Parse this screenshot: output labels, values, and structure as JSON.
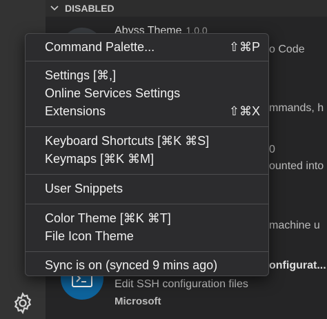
{
  "section": {
    "header": "DISABLED"
  },
  "extensions": [
    {
      "title": "Abyss Theme",
      "version": "1.0.0"
    }
  ],
  "background_fragments": {
    "frag1": "o Code",
    "frag2": "mmands, h",
    "frag3": "0",
    "frag4": "ounted into",
    "frag5": "machine u"
  },
  "ssh_extension": {
    "title": "SSH - configurat...",
    "title_visible": "onfigurat...",
    "description": "Edit SSH configuration files",
    "publisher": "Microsoft"
  },
  "menu": {
    "command_palette": {
      "label": "Command Palette...",
      "shortcut": "⇧⌘P"
    },
    "settings": {
      "label": "Settings [⌘,]"
    },
    "online_services": {
      "label": "Online Services Settings"
    },
    "extensions": {
      "label": "Extensions",
      "shortcut": "⇧⌘X"
    },
    "keyboard_shortcuts": {
      "label": "Keyboard Shortcuts [⌘K ⌘S]"
    },
    "keymaps": {
      "label": "Keymaps [⌘K ⌘M]"
    },
    "user_snippets": {
      "label": "User Snippets"
    },
    "color_theme": {
      "label": "Color Theme [⌘K ⌘T]"
    },
    "file_icon_theme": {
      "label": "File Icon Theme"
    },
    "sync": {
      "label": "Sync is on (synced 9 mins ago)"
    }
  },
  "colors": {
    "menu_bg": "#2c2c2e",
    "activity_bar": "#333333",
    "sidebar": "#252526",
    "ssh_icon_bg": "#0e639c"
  },
  "icons": {
    "manage": "gear-icon",
    "chevron": "chevron-down-icon",
    "ssh": "terminal-icon"
  }
}
